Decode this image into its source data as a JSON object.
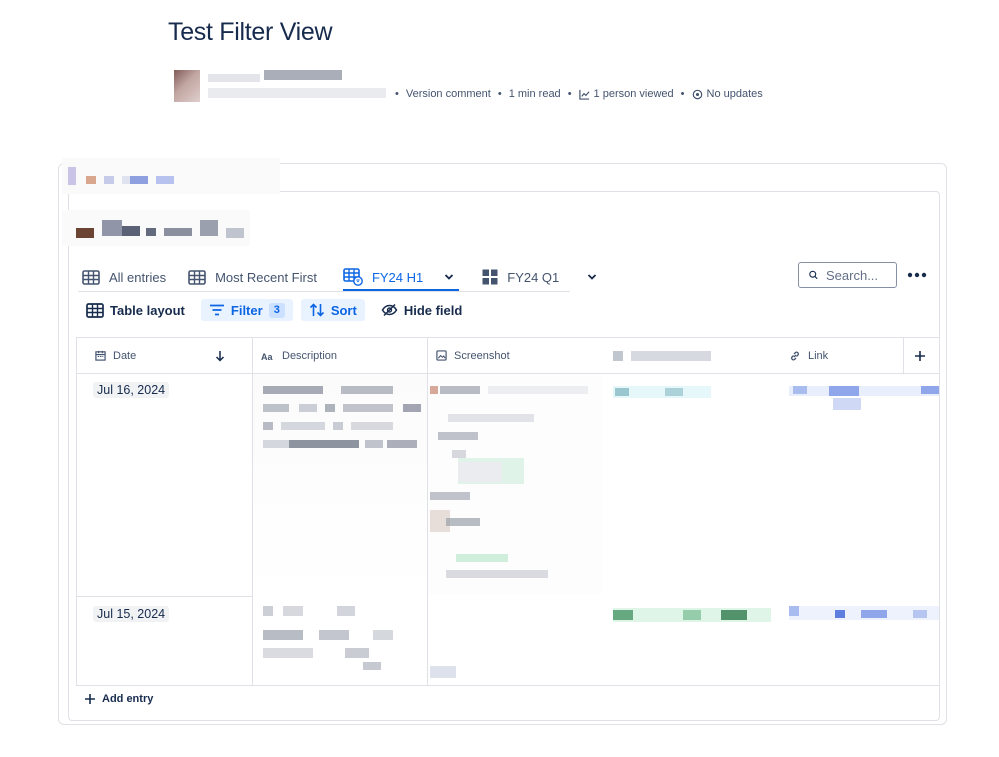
{
  "page": {
    "title": "Test Filter View"
  },
  "meta": {
    "version_comment": "Version comment",
    "read_time": "1 min read",
    "viewers": "1 person viewed",
    "updates": "No updates"
  },
  "tabs": [
    {
      "label": "All entries",
      "icon": "table-icon"
    },
    {
      "label": "Most Recent First",
      "icon": "table-icon"
    },
    {
      "label": "FY24 H1",
      "icon": "table-filtered-icon",
      "active": true
    },
    {
      "label": "FY24 Q1",
      "icon": "grid-icon"
    }
  ],
  "search": {
    "placeholder": "Search..."
  },
  "toolbar": {
    "layout_label": "Table layout",
    "filter_label": "Filter",
    "filter_count": "3",
    "sort_label": "Sort",
    "hide_label": "Hide field"
  },
  "table": {
    "columns": {
      "date": "Date",
      "description": "Description",
      "screenshot": "Screenshot",
      "link": "Link"
    },
    "rows": [
      {
        "date": "Jul 16, 2024"
      },
      {
        "date": "Jul 15, 2024"
      }
    ],
    "add_entry_label": "Add entry"
  },
  "colors": {
    "accent": "#0c66e4",
    "text": "#172b4d",
    "subtle": "#44546f",
    "border": "#dfe1e6"
  }
}
